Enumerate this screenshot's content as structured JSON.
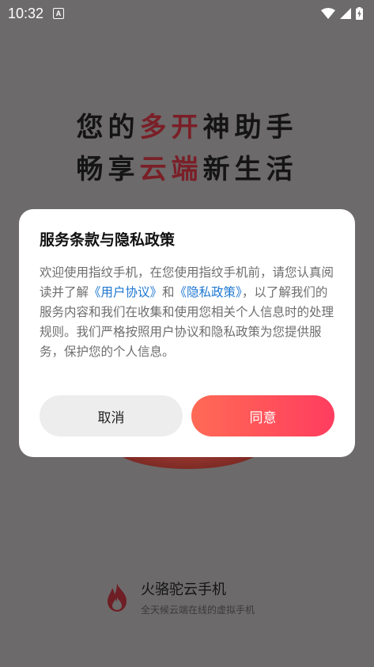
{
  "status_bar": {
    "time": "10:32",
    "notification_icon_letter": "A"
  },
  "background": {
    "headline_line1": {
      "normal_a": "您的",
      "accent": "多开",
      "normal_b": "神助手"
    },
    "headline_line2": {
      "normal_a": "畅享",
      "accent": "云端",
      "normal_b": "新生活"
    }
  },
  "dialog": {
    "title": "服务条款与隐私政策",
    "body_part1": "欢迎使用指纹手机，在您使用指纹手机前，请您认真阅读并了解",
    "link_user_agreement": "《用户协议》",
    "body_and": "和",
    "link_privacy_policy": "《隐私政策》",
    "body_part2": "，以了解我们的服务内容和我们在收集和使用您相关个人信息时的处理规则。我们严格按照用户协议和隐私政策为您提供服务，保护您的个人信息。",
    "cancel_label": "取消",
    "agree_label": "同意"
  },
  "brand": {
    "name": "火骆驼云手机",
    "slogan": "全天候云端在线的虚拟手机"
  },
  "colors": {
    "overlay_bg": "#6c6a6b",
    "accent_text": "#7a1f27",
    "link": "#1e78d2",
    "agree_gradient_start": "#ff6a55",
    "agree_gradient_end": "#ff3d5f"
  }
}
